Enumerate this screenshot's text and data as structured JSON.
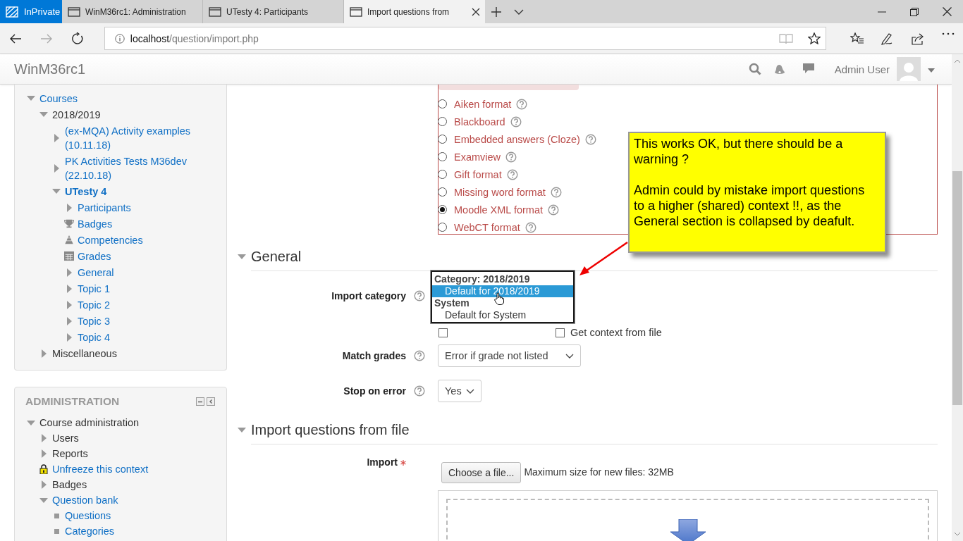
{
  "browser": {
    "private_label": "InPrivate",
    "tabs": [
      {
        "label": "WinM36rc1: Administration",
        "selected": false
      },
      {
        "label": "UTesty 4: Participants",
        "selected": false
      },
      {
        "label": "Import questions from",
        "selected": true
      }
    ],
    "address": {
      "host": "localhost",
      "path": "/question/import.php"
    }
  },
  "site": {
    "name": "WinM36rc1",
    "user": "Admin User"
  },
  "navigation": {
    "items": [
      {
        "label": "Courses",
        "kind": "toggle",
        "expanded": true,
        "link": true,
        "children": [
          {
            "label": "2018/2019",
            "kind": "toggle",
            "expanded": true,
            "link": false,
            "children": [
              {
                "label": "(ex-MQA) Activity examples (10.11.18)",
                "kind": "toggle",
                "expanded": false,
                "link": true
              },
              {
                "label": "PK Activities Tests M36dev (22.10.18)",
                "kind": "toggle",
                "expanded": false,
                "link": true
              },
              {
                "label": "UTesty 4",
                "kind": "toggle",
                "expanded": true,
                "link": true,
                "current": true,
                "children": [
                  {
                    "label": "Participants",
                    "kind": "toggle",
                    "expanded": false,
                    "link": true
                  },
                  {
                    "label": "Badges",
                    "kind": "trophy",
                    "link": true
                  },
                  {
                    "label": "Competencies",
                    "kind": "pyramid",
                    "link": true
                  },
                  {
                    "label": "Grades",
                    "kind": "grid",
                    "link": true
                  },
                  {
                    "label": "General",
                    "kind": "toggle",
                    "expanded": false,
                    "link": true
                  },
                  {
                    "label": "Topic 1",
                    "kind": "toggle",
                    "expanded": false,
                    "link": true
                  },
                  {
                    "label": "Topic 2",
                    "kind": "toggle",
                    "expanded": false,
                    "link": true
                  },
                  {
                    "label": "Topic 3",
                    "kind": "toggle",
                    "expanded": false,
                    "link": true
                  },
                  {
                    "label": "Topic 4",
                    "kind": "toggle",
                    "expanded": false,
                    "link": true
                  }
                ]
              }
            ]
          },
          {
            "label": "Miscellaneous",
            "kind": "toggle",
            "expanded": false,
            "link": false
          }
        ]
      }
    ]
  },
  "administration": {
    "title": "ADMINISTRATION",
    "items": [
      {
        "label": "Course administration",
        "kind": "toggle",
        "expanded": true,
        "link": false,
        "children": [
          {
            "label": "Users",
            "kind": "toggle",
            "expanded": false,
            "link": false
          },
          {
            "label": "Reports",
            "kind": "toggle",
            "expanded": false,
            "link": false
          },
          {
            "label": "Unfreeze this context",
            "kind": "lock",
            "link": true
          },
          {
            "label": "Badges",
            "kind": "toggle",
            "expanded": false,
            "link": false
          },
          {
            "label": "Question bank",
            "kind": "toggle",
            "expanded": true,
            "link": true,
            "children": [
              {
                "label": "Questions",
                "kind": "bullet",
                "link": true
              },
              {
                "label": "Categories",
                "kind": "bullet",
                "link": true
              }
            ]
          }
        ]
      }
    ]
  },
  "import_form": {
    "formats": [
      {
        "label": "Aiken format",
        "selected": false
      },
      {
        "label": "Blackboard",
        "selected": false
      },
      {
        "label": "Embedded answers (Cloze)",
        "selected": false
      },
      {
        "label": "Examview",
        "selected": false
      },
      {
        "label": "Gift format",
        "selected": false
      },
      {
        "label": "Missing word format",
        "selected": false
      },
      {
        "label": "Moodle XML format",
        "selected": true
      },
      {
        "label": "WebCT format",
        "selected": false
      }
    ],
    "general": {
      "title": "General",
      "expanded": true,
      "import_category": {
        "label": "Import category",
        "groups": [
          {
            "label": "Category: 2018/2019",
            "options": [
              {
                "label": "Default for 2018/2019",
                "selected": true
              }
            ]
          },
          {
            "label": "System",
            "options": [
              {
                "label": "Default for System",
                "selected": false
              }
            ]
          }
        ]
      },
      "options": [
        {
          "checked": false
        },
        {
          "label": "Get context from file",
          "checked": false
        }
      ],
      "match_grades": {
        "label": "Match grades",
        "value": "Error if grade not listed"
      },
      "stop_on_error": {
        "label": "Stop on error",
        "value": "Yes"
      }
    },
    "file_section": {
      "title": "Import questions from file",
      "expanded": true,
      "label": "Import",
      "required": true,
      "button": "Choose a file...",
      "note": "Maximum size for new files: 32MB"
    }
  },
  "callout": {
    "paragraphs": [
      "This works OK, but there should be a warning ?",
      "Admin could by mistake import questions to a higher (shared) context !!, as the General section is collapsed by deafult."
    ]
  }
}
